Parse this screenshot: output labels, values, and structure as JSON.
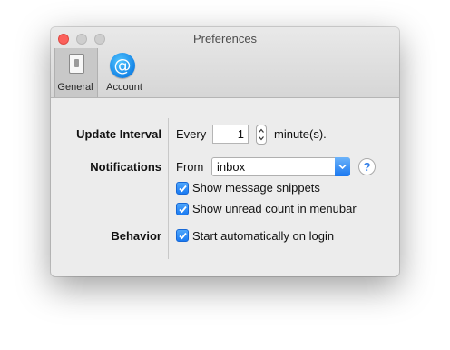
{
  "window": {
    "title": "Preferences"
  },
  "toolbar": {
    "items": [
      {
        "label": "General",
        "icon": "switch-icon",
        "selected": true
      },
      {
        "label": "Account",
        "icon": "at-sign-icon",
        "selected": false
      }
    ]
  },
  "update_interval": {
    "label": "Update Interval",
    "prefix": "Every",
    "value": "1",
    "suffix": "minute(s)."
  },
  "notifications": {
    "label": "Notifications",
    "prefix": "From",
    "selected": "inbox",
    "help": "?",
    "options": [
      {
        "label": "Show message snippets",
        "checked": true
      },
      {
        "label": "Show unread count in menubar",
        "checked": true
      }
    ]
  },
  "behavior": {
    "label": "Behavior",
    "options": [
      {
        "label": "Start automatically on login",
        "checked": true
      }
    ]
  },
  "colors": {
    "accent": "#1a7af2",
    "close": "#fc605b"
  }
}
